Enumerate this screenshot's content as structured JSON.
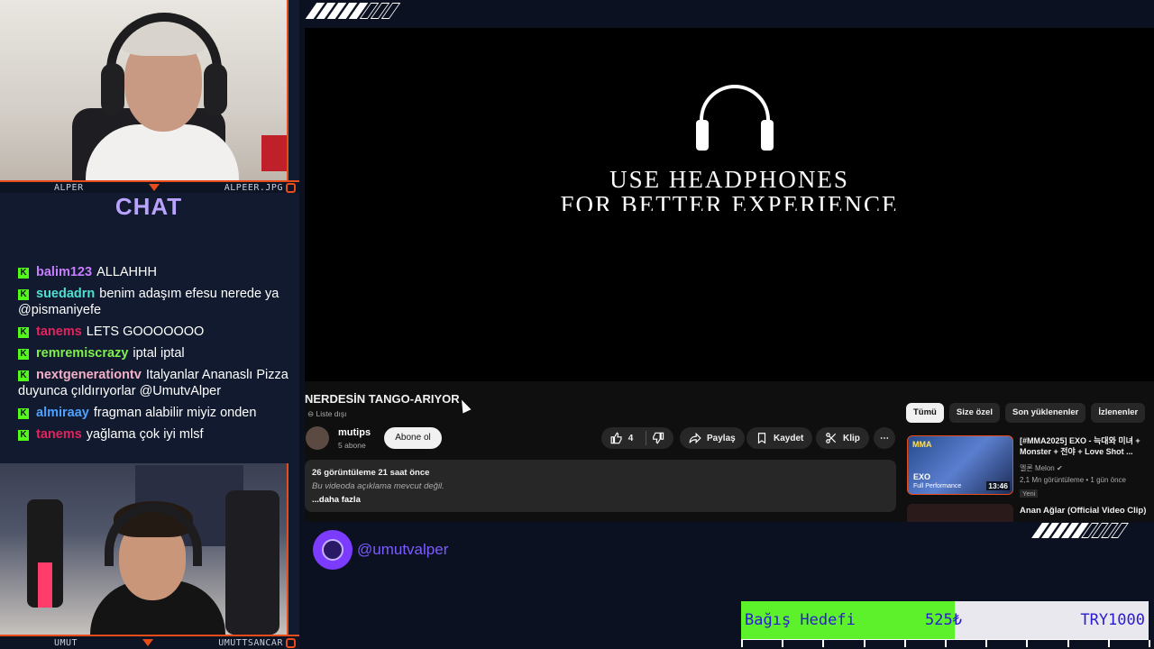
{
  "webcam_top": {
    "left_label": "ALPER",
    "right_label": "ALPEER.JPG"
  },
  "webcam_bottom": {
    "left_label": "UMUT",
    "right_label": "UMUTTSANCAR"
  },
  "chat": {
    "title": "CHAT",
    "messages": [
      {
        "user": "balim123",
        "text": "ALLAHHH",
        "color": "#c77dff"
      },
      {
        "user": "suedadrn",
        "text": "benim adaşım efesu nerede ya @pismaniyefe",
        "color": "#4ee0d1"
      },
      {
        "user": "tanems",
        "text": "LETS GOOOOOOO",
        "color": "#e0245e"
      },
      {
        "user": "remremiscrazy",
        "text": "iptal iptal",
        "color": "#7df24a"
      },
      {
        "user": "nextgenerationtv",
        "text": "Italyanlar Ananaslı Pizza duyunca çıldırıyorlar @UmutvAlper",
        "color": "#f5b1c8"
      },
      {
        "user": "almiraay",
        "text": "fragman alabilir miyiz onden",
        "color": "#4ea1ff"
      },
      {
        "user": "tanems",
        "text": "yağlama çok iyi mlsf",
        "color": "#e0245e"
      }
    ]
  },
  "video": {
    "line1": "USE HEADPHONES",
    "line2": "FOR BETTER EXPERIENCE"
  },
  "youtube": {
    "title": "NERDESİN TANGO-ARIYOR",
    "badge": "⊖ Liste dışı",
    "channel": "mutips",
    "subs": "5 abone",
    "subscribe": "Abone ol",
    "like_count": "4",
    "share": "Paylaş",
    "save": "Kaydet",
    "clip": "Klip",
    "more": "⋯",
    "stats": "26 görüntüleme  21 saat önce",
    "no_desc": "Bu videoda açıklama mevcut değil.",
    "show_more": "...daha fazla",
    "chips": [
      "Tümü",
      "Size özel",
      "Son yüklenenler",
      "İzlenenler"
    ],
    "rec1": {
      "title": "[#MMA2025] EXO - 늑대와 미녀 + Monster + 전야 + Love Shot ...",
      "channel": "멜론 Melon ✔",
      "meta": "2,1 Mn görüntüleme • 1 gün önce",
      "new": "Yeni",
      "duration": "13:46",
      "thumb_logo": "MMA",
      "thumb_group": "EXO",
      "thumb_sub": "Full Performance"
    },
    "rec2": {
      "title": "Anan Ağlar (Official Video Clip)"
    }
  },
  "social": {
    "handle": "@umutvalper"
  },
  "donation_goal": {
    "label": "Bağış Hedefi",
    "current": "525₺",
    "target": "TRY1000",
    "progress": 0.525
  },
  "colors": {
    "accent": "#e84c1a",
    "kick_green": "#53fc18",
    "goal_fill": "#5cf12a"
  }
}
